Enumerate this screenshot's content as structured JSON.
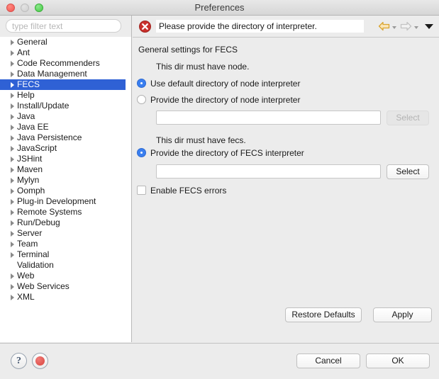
{
  "window": {
    "title": "Preferences",
    "controls": {
      "close": "close-button",
      "minimize": "minimize-button",
      "maximize": "maximize-button"
    }
  },
  "sidebar": {
    "filter": {
      "value": "",
      "placeholder": "type filter text"
    },
    "items": [
      {
        "label": "General",
        "expandable": true,
        "selected": false
      },
      {
        "label": "Ant",
        "expandable": true,
        "selected": false
      },
      {
        "label": "Code Recommenders",
        "expandable": true,
        "selected": false
      },
      {
        "label": "Data Management",
        "expandable": true,
        "selected": false
      },
      {
        "label": "FECS",
        "expandable": true,
        "selected": true
      },
      {
        "label": "Help",
        "expandable": true,
        "selected": false
      },
      {
        "label": "Install/Update",
        "expandable": true,
        "selected": false
      },
      {
        "label": "Java",
        "expandable": true,
        "selected": false
      },
      {
        "label": "Java EE",
        "expandable": true,
        "selected": false
      },
      {
        "label": "Java Persistence",
        "expandable": true,
        "selected": false
      },
      {
        "label": "JavaScript",
        "expandable": true,
        "selected": false
      },
      {
        "label": "JSHint",
        "expandable": true,
        "selected": false
      },
      {
        "label": "Maven",
        "expandable": true,
        "selected": false
      },
      {
        "label": "Mylyn",
        "expandable": true,
        "selected": false
      },
      {
        "label": "Oomph",
        "expandable": true,
        "selected": false
      },
      {
        "label": "Plug-in Development",
        "expandable": true,
        "selected": false
      },
      {
        "label": "Remote Systems",
        "expandable": true,
        "selected": false
      },
      {
        "label": "Run/Debug",
        "expandable": true,
        "selected": false
      },
      {
        "label": "Server",
        "expandable": true,
        "selected": false
      },
      {
        "label": "Team",
        "expandable": true,
        "selected": false
      },
      {
        "label": "Terminal",
        "expandable": true,
        "selected": false
      },
      {
        "label": "Validation",
        "expandable": false,
        "selected": false
      },
      {
        "label": "Web",
        "expandable": true,
        "selected": false
      },
      {
        "label": "Web Services",
        "expandable": true,
        "selected": false
      },
      {
        "label": "XML",
        "expandable": true,
        "selected": false
      }
    ]
  },
  "message_bar": {
    "icon": "error-icon",
    "text": "Please provide the directory of interpreter.",
    "back_arrow": "back-arrow-icon",
    "forward_arrow": "forward-arrow-icon",
    "menu_arrow": "dropdown-arrow-icon"
  },
  "main": {
    "section_title": "General settings for FECS",
    "node_hint": "This dir must have node.",
    "radio_use_default_node": "Use default directory of node interpreter",
    "radio_provide_node": "Provide the directory of node interpreter",
    "node_dir_value": "",
    "node_select_label": "Select",
    "fecs_hint": "This dir must have fecs.",
    "radio_provide_fecs": "Provide the directory of FECS interpreter",
    "fecs_dir_value": "",
    "fecs_select_label": "Select",
    "enable_fecs_errors": "Enable FECS errors",
    "restore_defaults_label": "Restore Defaults",
    "apply_label": "Apply"
  },
  "footer": {
    "help_icon": "?",
    "record_icon": "record-icon",
    "cancel_label": "Cancel",
    "ok_label": "OK"
  },
  "colors": {
    "selection_blue": "#2f61d5",
    "radio_blue": "#3a7ff0",
    "error_red": "#c9302c",
    "back_arrow_gold": "#e2a927",
    "window_bg": "#ececec"
  }
}
